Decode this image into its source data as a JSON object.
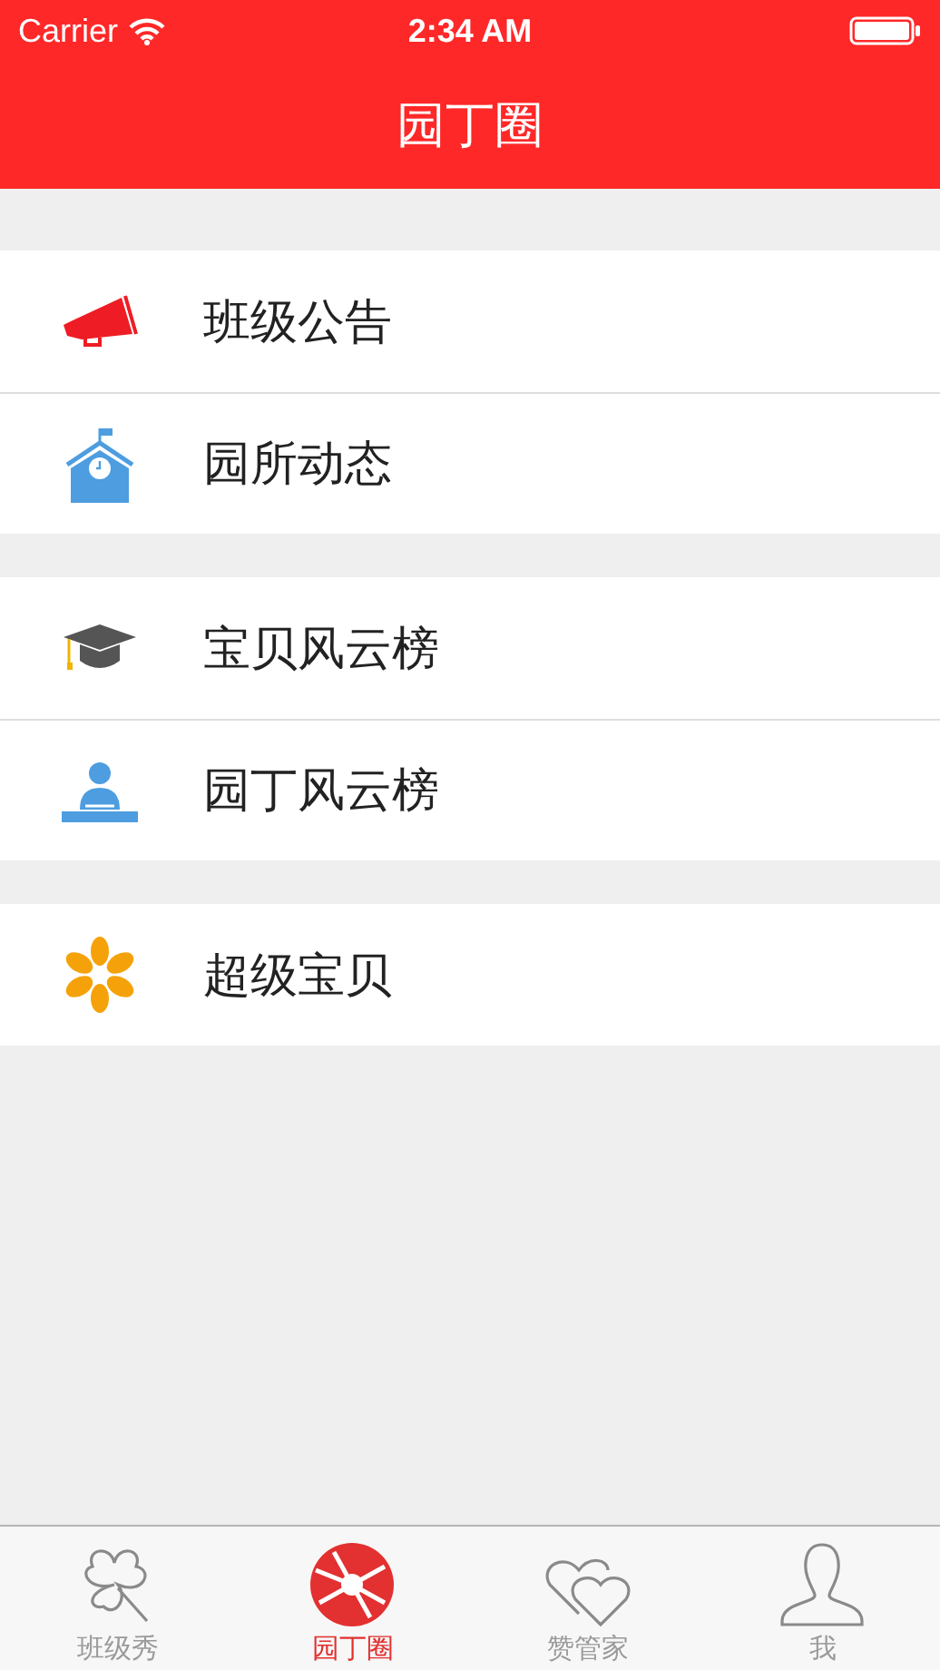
{
  "status_bar": {
    "carrier": "Carrier",
    "time": "2:34 AM"
  },
  "nav_bar": {
    "title": "园丁圈"
  },
  "groups": [
    {
      "items": [
        {
          "kind": "megaphone",
          "label": "班级公告"
        },
        {
          "kind": "school",
          "label": "园所动态"
        }
      ]
    },
    {
      "items": [
        {
          "kind": "graduation",
          "label": "宝贝风云榜"
        },
        {
          "kind": "teacher",
          "label": "园丁风云榜"
        }
      ]
    },
    {
      "items": [
        {
          "kind": "flower",
          "label": "超级宝贝"
        }
      ]
    }
  ],
  "tab_bar": [
    {
      "kind": "clover",
      "label": "班级秀",
      "selected": false
    },
    {
      "kind": "aperture",
      "label": "园丁圈",
      "selected": true
    },
    {
      "kind": "hearts",
      "label": "赞管家",
      "selected": false
    },
    {
      "kind": "person",
      "label": "我",
      "selected": false
    }
  ]
}
